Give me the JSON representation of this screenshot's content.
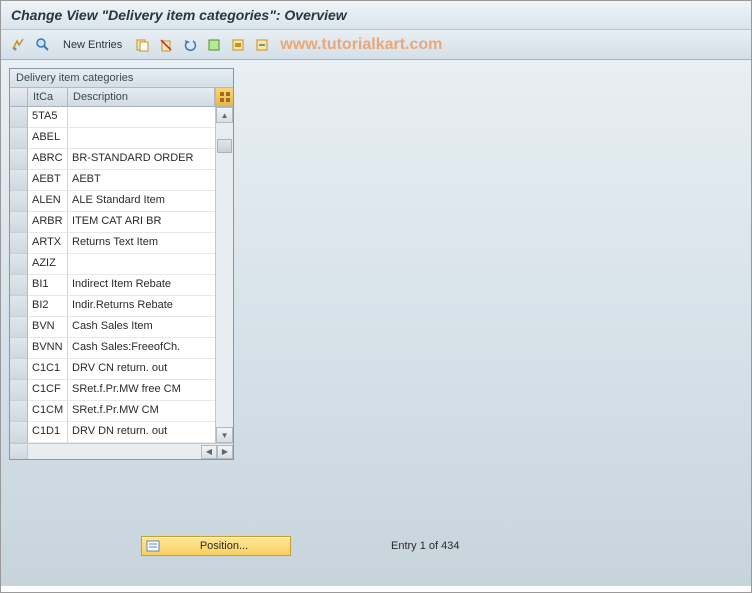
{
  "title": "Change View \"Delivery item categories\": Overview",
  "toolbar": {
    "new_entries_label": "New Entries"
  },
  "watermark": "www.tutorialkart.com",
  "table": {
    "panel_title": "Delivery item categories",
    "columns": {
      "itca": "ItCa",
      "description": "Description"
    },
    "rows": [
      {
        "itca": "5TA5",
        "desc": ""
      },
      {
        "itca": "ABEL",
        "desc": ""
      },
      {
        "itca": "ABRC",
        "desc": "BR-STANDARD ORDER"
      },
      {
        "itca": "AEBT",
        "desc": "AEBT"
      },
      {
        "itca": "ALEN",
        "desc": "ALE Standard Item"
      },
      {
        "itca": "ARBR",
        "desc": "ITEM CAT ARI BR"
      },
      {
        "itca": "ARTX",
        "desc": "Returns Text Item"
      },
      {
        "itca": "AZIZ",
        "desc": ""
      },
      {
        "itca": "BI1",
        "desc": "Indirect Item Rebate"
      },
      {
        "itca": "BI2",
        "desc": "Indir.Returns Rebate"
      },
      {
        "itca": "BVN",
        "desc": "Cash Sales Item"
      },
      {
        "itca": "BVNN",
        "desc": "Cash Sales:FreeofCh."
      },
      {
        "itca": "C1C1",
        "desc": "DRV CN return. out"
      },
      {
        "itca": "C1CF",
        "desc": "SRet.f.Pr.MW free CM"
      },
      {
        "itca": "C1CM",
        "desc": "SRet.f.Pr.MW CM"
      },
      {
        "itca": "C1D1",
        "desc": "DRV DN return. out"
      }
    ]
  },
  "footer": {
    "position_label": "Position...",
    "entry_text": "Entry 1 of 434"
  }
}
